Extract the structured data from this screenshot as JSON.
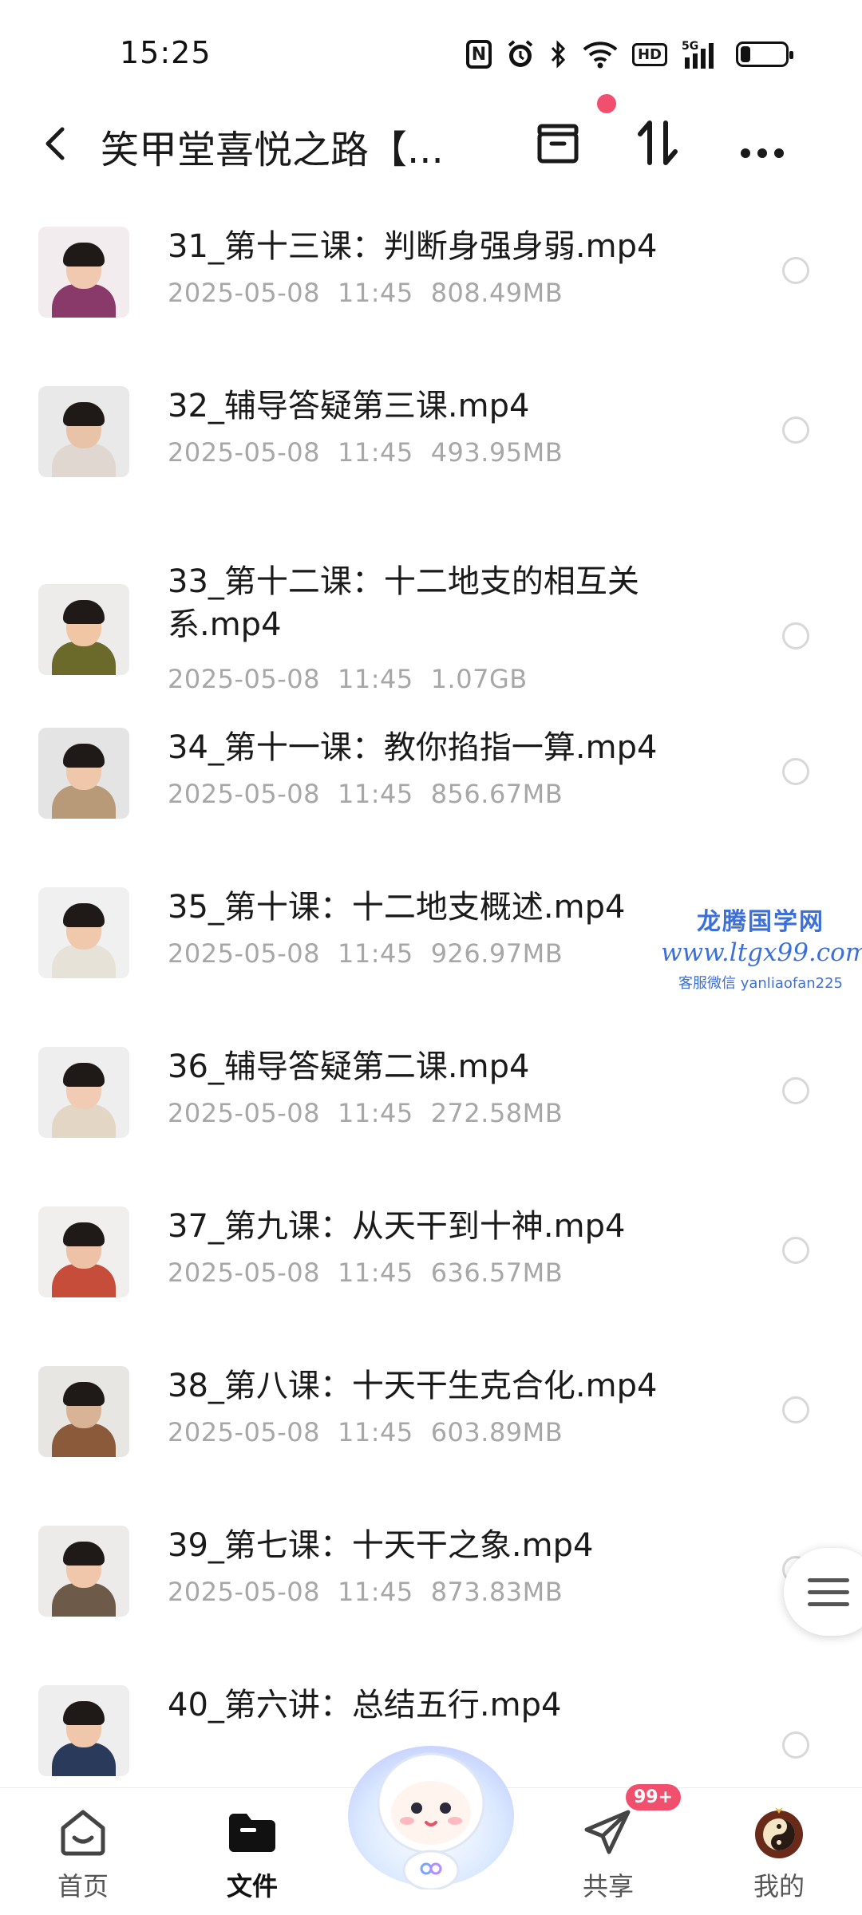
{
  "status_bar": {
    "time": "15:25",
    "icons": [
      "nfc-icon",
      "alarm-icon",
      "bluetooth-icon",
      "wifi-icon",
      "hd-icon",
      "5g-signal-icon",
      "battery-icon"
    ],
    "hd_label": "HD",
    "nfc_label": "N",
    "network": "5G",
    "battery_level": 0.22
  },
  "header": {
    "title": "笑甲堂喜悦之路【...",
    "notification_dot_color": "#f0506e",
    "icons": [
      "back-icon",
      "transfer-box-icon",
      "sort-icon",
      "more-icon"
    ]
  },
  "files": [
    {
      "name": "31_第十三课：判断身强身弱.mp4",
      "date": "2025-05-08",
      "time": "11:45",
      "size": "808.49MB"
    },
    {
      "name": "32_辅导答疑第三课.mp4",
      "date": "2025-05-08",
      "time": "11:45",
      "size": "493.95MB"
    },
    {
      "name": "33_第十二课：十二地支的相互关系.mp4",
      "date": "2025-05-08",
      "time": "11:45",
      "size": "1.07GB"
    },
    {
      "name": "34_第十一课：教你掐指一算.mp4",
      "date": "2025-05-08",
      "time": "11:45",
      "size": "856.67MB"
    },
    {
      "name": "35_第十课：十二地支概述.mp4",
      "date": "2025-05-08",
      "time": "11:45",
      "size": "926.97MB"
    },
    {
      "name": "36_辅导答疑第二课.mp4",
      "date": "2025-05-08",
      "time": "11:45",
      "size": "272.58MB"
    },
    {
      "name": "37_第九课：从天干到十神.mp4",
      "date": "2025-05-08",
      "time": "11:45",
      "size": "636.57MB"
    },
    {
      "name": "38_第八课：十天干生克合化.mp4",
      "date": "2025-05-08",
      "time": "11:45",
      "size": "603.89MB"
    },
    {
      "name": "39_第七课：十天干之象.mp4",
      "date": "2025-05-08",
      "time": "11:45",
      "size": "873.83MB"
    },
    {
      "name": "40_第六讲：总结五行.mp4",
      "date": "",
      "time": "",
      "size": ""
    }
  ],
  "watermark": {
    "title": "龙腾国学网",
    "url": "www.ltgx99.com",
    "contact": "客服微信 yanliaofan225"
  },
  "bottom_nav": {
    "items": [
      {
        "label": "首页",
        "icon": "home-icon",
        "active": false
      },
      {
        "label": "文件",
        "icon": "folder-icon",
        "active": true
      },
      {
        "label": "",
        "icon": "ai-mascot-icon",
        "active": false
      },
      {
        "label": "共享",
        "icon": "share-plane-icon",
        "active": false
      },
      {
        "label": "我的",
        "icon": "yin-yang-avatar-icon",
        "active": false
      }
    ],
    "share_badge": "99+"
  },
  "colors": {
    "accent_red": "#f0506e",
    "meta_gray": "#a7a7a7",
    "watermark_blue": "#3d6fd8"
  }
}
